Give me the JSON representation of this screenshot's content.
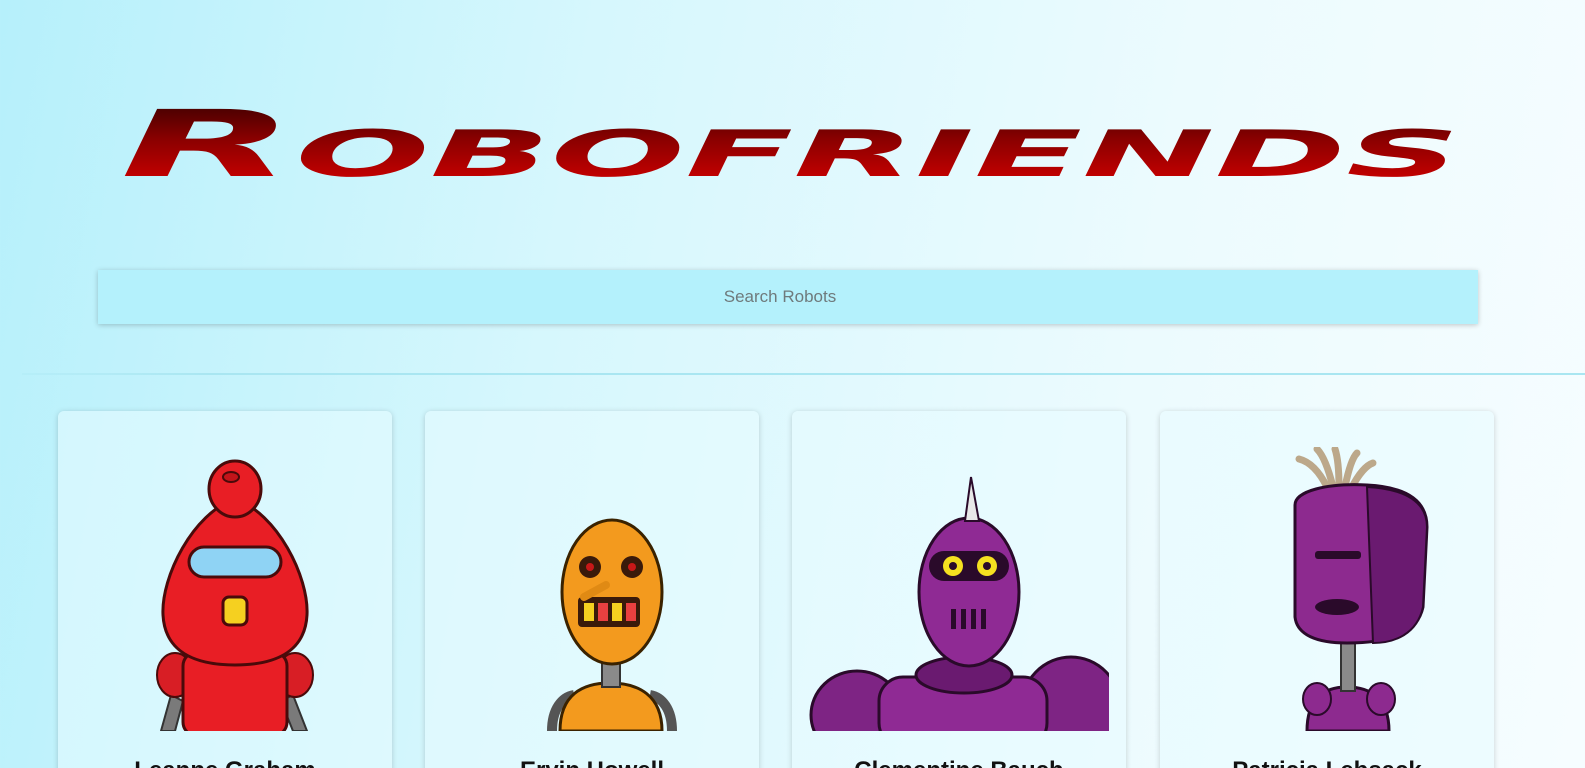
{
  "header": {
    "title": "Robofriends",
    "title_colors": [
      "#2b0000",
      "#8a0000",
      "#e00000"
    ]
  },
  "search": {
    "placeholder": "Search Robots",
    "value": "",
    "background": "#b4f1fc"
  },
  "robots": [
    {
      "name": "Leanne Graham",
      "avatar": "red-robot-avatar",
      "color": "#e81e25"
    },
    {
      "name": "Ervin Howell",
      "avatar": "orange-robot-avatar",
      "color": "#f39a1e"
    },
    {
      "name": "Clementine Bauch",
      "avatar": "purple-robot-avatar",
      "color": "#8f2a94"
    },
    {
      "name": "Patricia Lebsack",
      "avatar": "purple-robot-avatar",
      "color": "#8d2a8f"
    }
  ]
}
